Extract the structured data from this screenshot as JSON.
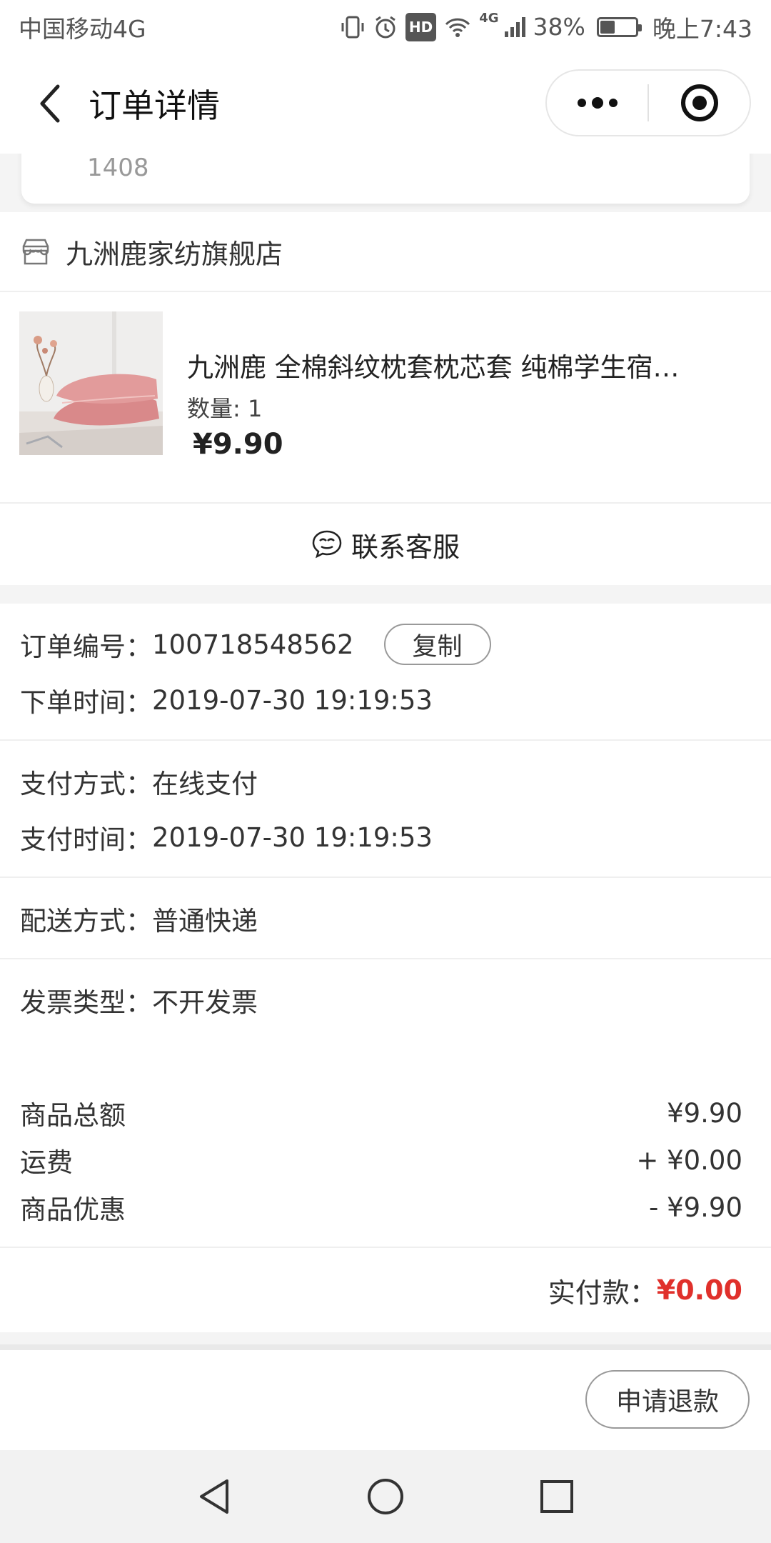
{
  "status_bar": {
    "carrier": "中国移动4G",
    "network_badge": "HD",
    "signal_label": "4G",
    "battery_text": "38%",
    "battery_level": 0.38,
    "time": "晚上7:43"
  },
  "nav": {
    "title": "订单详情"
  },
  "address": {
    "tail_text": "1408"
  },
  "store": {
    "name": "九洲鹿家纺旗舰店",
    "item": {
      "name": "九洲鹿 全棉斜纹枕套枕芯套 纯棉学生宿…",
      "quantity_label": "数量: 1",
      "price": "¥9.90"
    },
    "service_label": "联系客服"
  },
  "order_info": {
    "order_no_key": "订单编号：",
    "order_no_value": "100718548562",
    "copy_label": "复制",
    "order_time_key": "下单时间：",
    "order_time_value": "2019-07-30 19:19:53",
    "pay_method_key": "支付方式：",
    "pay_method_value": "在线支付",
    "pay_time_key": "支付时间：",
    "pay_time_value": "2019-07-30 19:19:53",
    "delivery_key": "配送方式：",
    "delivery_value": "普通快递",
    "invoice_key": "发票类型：",
    "invoice_value": "不开发票"
  },
  "amounts": {
    "goods_total_label": "商品总额",
    "goods_total_value": "¥9.90",
    "freight_label": "运费",
    "freight_value": "+ ¥0.00",
    "discount_label": "商品优惠",
    "discount_value": "- ¥9.90",
    "paid_label": "实付款：",
    "paid_value": "¥0.00"
  },
  "actions": {
    "refund_label": "申请退款"
  },
  "colors": {
    "accent_red": "#e0302b",
    "background": "#f4f4f4"
  }
}
